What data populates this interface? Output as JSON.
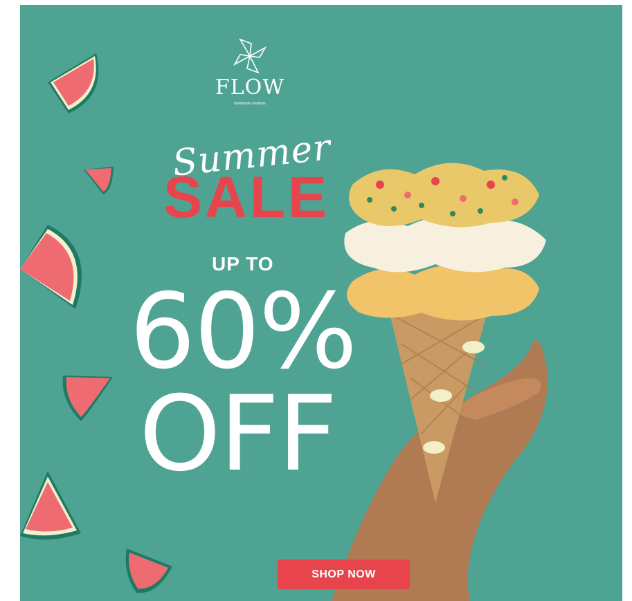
{
  "brand": {
    "name": "FLOW",
    "tagline": "handmade creations",
    "logo_icon": "pinwheel-icon"
  },
  "promo": {
    "script_word": "Summer",
    "headline": "SALE",
    "prefix": "UP TO",
    "discount": "60%",
    "suffix": "OFF"
  },
  "cta": {
    "label": "SHOP NOW"
  },
  "colors": {
    "background": "#4fa393",
    "accent": "#e8444c",
    "text": "#ffffff",
    "melon_flesh": "#ef6b72",
    "melon_rind": "#1f7a63",
    "melon_pith": "#f4efcf"
  },
  "decor": {
    "melon_icon": "watermelon-slice-icon",
    "product_image": "scrunchie-ice-cream-cone-photo"
  }
}
